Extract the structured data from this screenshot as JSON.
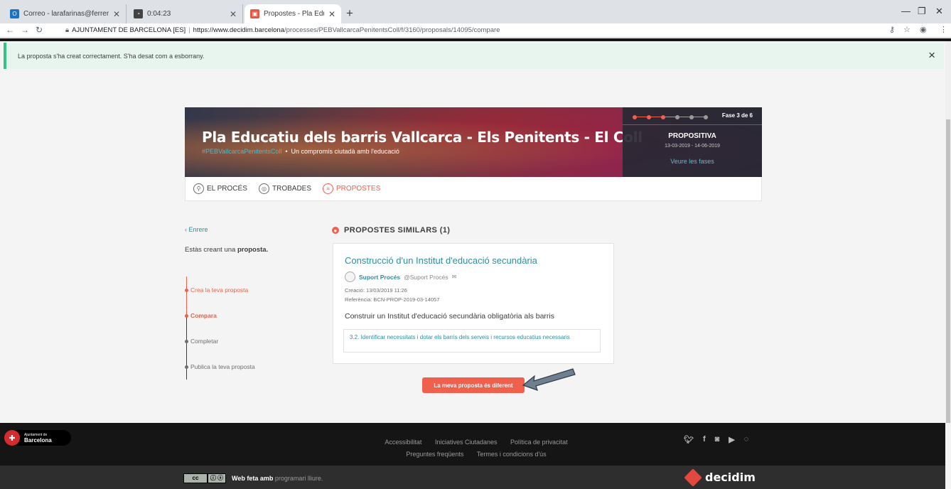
{
  "browser": {
    "tabs": [
      {
        "title": "Correo - larafarinas@ferrerguard",
        "favicon_color": "#1a73c8"
      },
      {
        "title": "0:04:23",
        "favicon_color": "#444444"
      },
      {
        "title": "Propostes - Pla Educatiu dels bar",
        "favicon_color": "#e05a47"
      }
    ],
    "new_tab_label": "+",
    "url": {
      "site_label": "AJUNTAMENT DE BARCELONA [ES]",
      "host": "https://www.decidim.barcelona",
      "path": "/processes/PEBVallcarcaPenitentsColl/f/3160/proposals/14095/compare"
    }
  },
  "callout": {
    "message": "La proposta s'ha creat correctament. S'ha desat com a esborrany.",
    "close_label": "×"
  },
  "hero": {
    "title": "Pla Educatiu dels barris Vallcarca - Els Penitents - El Coll",
    "hashtag": "#PEBVallcarcaPenitentsColl",
    "subtitle": "Un compromís ciutadà amb l'educació",
    "phase": {
      "counter": "Fase 3 de 6",
      "name": "PROPOSITIVA",
      "dates": "13-03-2019 - 14-06-2019",
      "link": "Veure les fases",
      "total_steps": 6,
      "current_step": 3
    }
  },
  "process_menu": {
    "items": [
      {
        "label": "EL PROCÉS",
        "icon": "process-icon"
      },
      {
        "label": "TROBADES",
        "icon": "meetings-icon"
      },
      {
        "label": "PROPOSTES",
        "icon": "proposals-icon"
      }
    ]
  },
  "wizard": {
    "back_label": "‹ Enrere",
    "intro_prefix": "Estàs creant una",
    "intro_bold": "proposta.",
    "steps": [
      {
        "label": "Crea la teva proposta",
        "state": "done"
      },
      {
        "label": "Compara",
        "state": "current"
      },
      {
        "label": "Completar",
        "state": "todo"
      },
      {
        "label": "Publica la teva proposta",
        "state": "todo"
      }
    ]
  },
  "similar": {
    "heading": "PROPOSTES SIMILARS (1)",
    "card": {
      "title": "Construcció d'un Institut d'educació secundària",
      "author_name": "Suport Procés",
      "author_nick": "@Suport Procés",
      "created": "Creació: 13/03/2019 11:26",
      "reference": "Referència: BCN-PROP-2019-03-14057",
      "body": "Construir un Institut d'educació secundària obligatòria als barris",
      "tag": "3.2. Identificar necessitats i dotar els barris dels serveis i recursos educatius necessaris"
    },
    "button_label": "La meva proposta és diferent"
  },
  "footer": {
    "logo_line1": "Ajuntament de",
    "logo_line2": "Barcelona",
    "links_row1": [
      "Accessibilitat",
      "Iniciatives Ciutadanes",
      "Política de privacitat"
    ],
    "links_row2": [
      "Preguntes freqüents",
      "Termes i condicions d'ús"
    ],
    "made_with": "Web feta amb",
    "free_software": "programari lliure.",
    "brand": "decidim"
  },
  "colors": {
    "accent": "#ef604d",
    "link": "#2e8fa1",
    "success": "#34c482"
  }
}
